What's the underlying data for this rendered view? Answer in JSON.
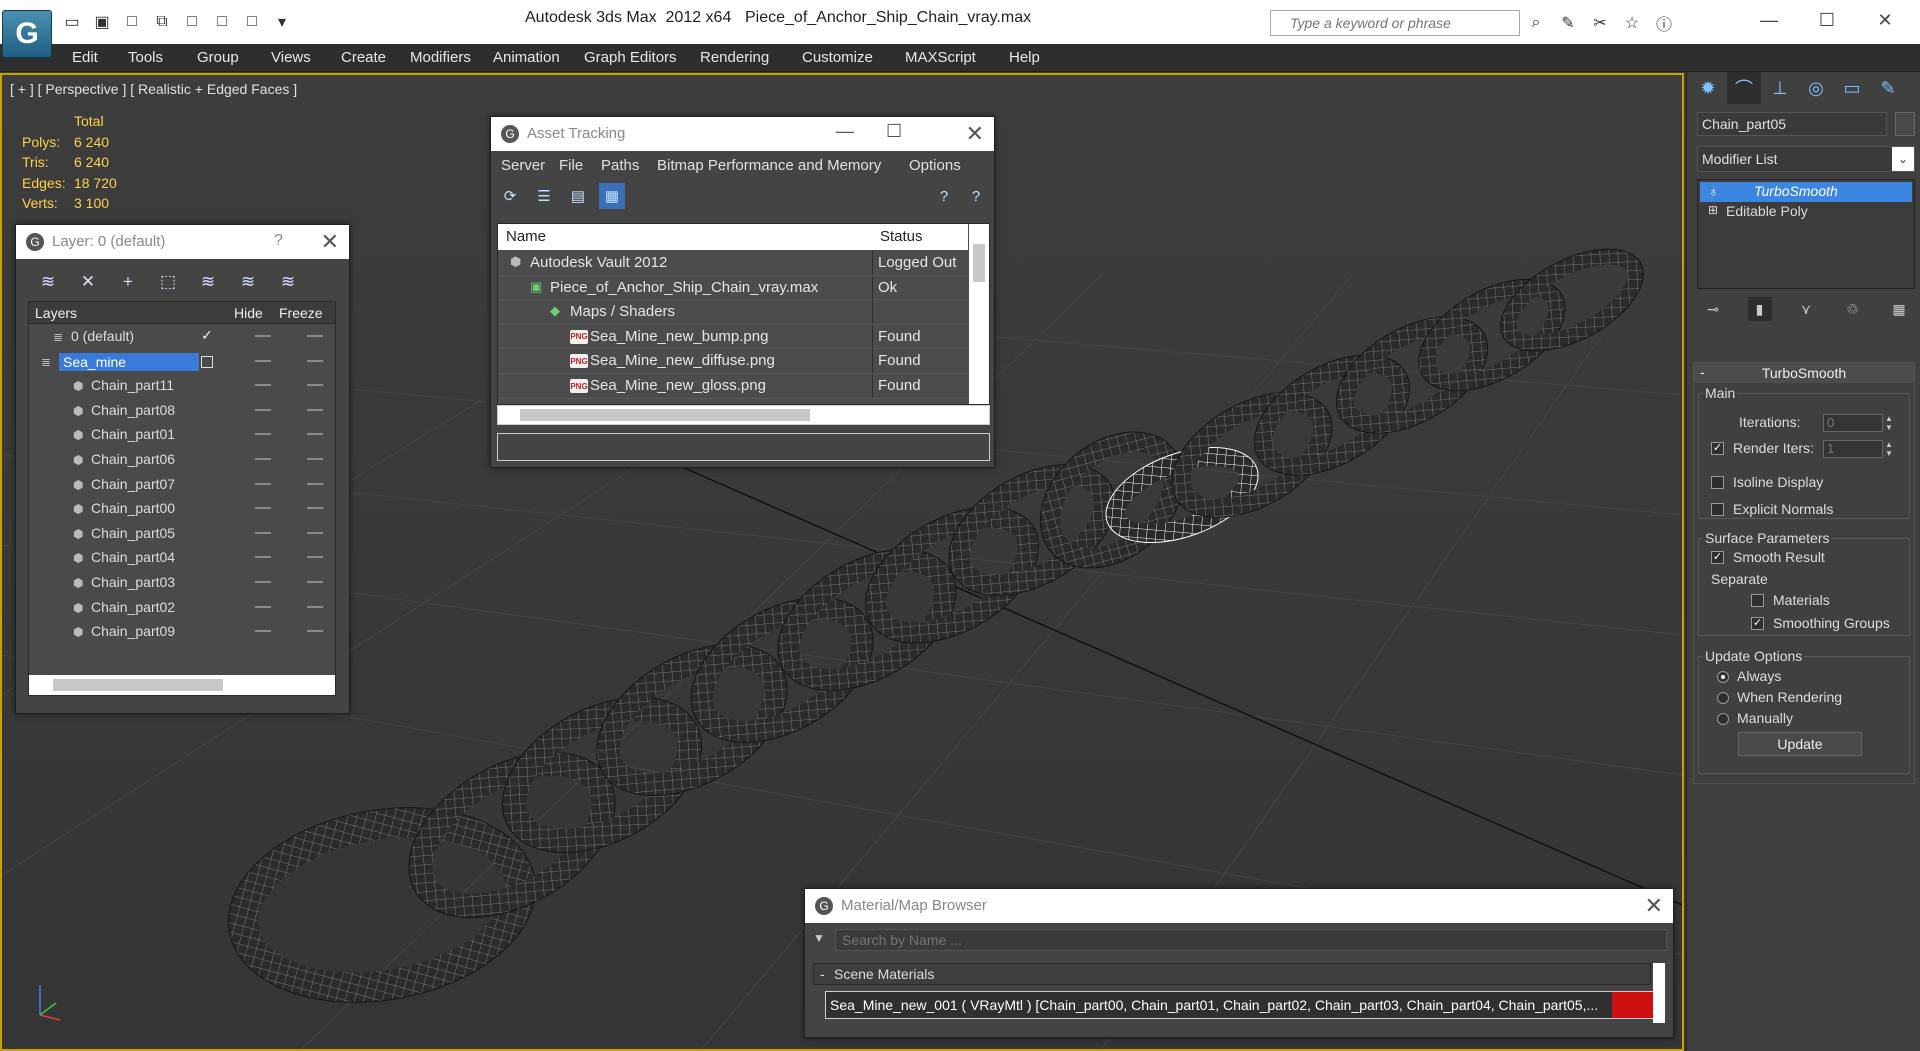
{
  "titlebar": {
    "app_title": "Autodesk 3ds Max  2012 x64",
    "file_name": "Piece_of_Anchor_Ship_Chain_vray.max",
    "search_placeholder": "Type a keyword or phrase"
  },
  "menu": [
    "Edit",
    "Tools",
    "Group",
    "Views",
    "Create",
    "Modifiers",
    "Animation",
    "Graph Editors",
    "Rendering",
    "Customize",
    "MAXScript",
    "Help"
  ],
  "viewport": {
    "label": "[ + ] [ Perspective ] [ Realistic + Edged Faces ]",
    "stats": {
      "header": "Total",
      "polys_label": "Polys:",
      "polys": "6 240",
      "tris_label": "Tris:",
      "tris": "6 240",
      "edges_label": "Edges:",
      "edges": "18 720",
      "verts_label": "Verts:",
      "verts": "3 100"
    }
  },
  "layer_window": {
    "title": "Layer: 0 (default)",
    "help": "?",
    "columns": {
      "layers": "Layers",
      "hide": "Hide",
      "freeze": "Freeze"
    },
    "rows": [
      "0 (default)",
      "Sea_mine",
      "Chain_part11",
      "Chain_part08",
      "Chain_part01",
      "Chain_part06",
      "Chain_part07",
      "Chain_part00",
      "Chain_part05",
      "Chain_part04",
      "Chain_part03",
      "Chain_part02",
      "Chain_part09"
    ]
  },
  "asset_window": {
    "title": "Asset Tracking",
    "menu": [
      "Server",
      "File",
      "Paths",
      "Bitmap Performance and Memory",
      "Options"
    ],
    "columns": {
      "name": "Name",
      "status": "Status"
    },
    "rows": [
      {
        "name": "Autodesk Vault 2012",
        "status": "Logged Out"
      },
      {
        "name": "Piece_of_Anchor_Ship_Chain_vray.max",
        "status": "Ok"
      },
      {
        "name": "Maps / Shaders",
        "status": ""
      },
      {
        "name": "Sea_Mine_new_bump.png",
        "status": "Found"
      },
      {
        "name": "Sea_Mine_new_diffuse.png",
        "status": "Found"
      },
      {
        "name": "Sea_Mine_new_gloss.png",
        "status": "Found"
      }
    ],
    "png_badge": "PNG"
  },
  "material_browser": {
    "title": "Material/Map Browser",
    "search_placeholder": "Search by Name ...",
    "section": "Scene Materials",
    "item": "Sea_Mine_new_001  ( VRayMtl )  [Chain_part00, Chain_part01, Chain_part02, Chain_part03, Chain_part04, Chain_part05,..."
  },
  "command_panel": {
    "object_name": "Chain_part05",
    "modifier_list": "Modifier List",
    "stack": [
      "TurboSmooth",
      "Editable Poly"
    ],
    "turbosmooth": {
      "title": "TurboSmooth",
      "main_group": "Main",
      "iterations_label": "Iterations:",
      "iterations": "0",
      "render_iters_label": "Render Iters:",
      "render_iters": "1",
      "isoline": "Isoline Display",
      "explicit": "Explicit Normals",
      "surface_group": "Surface Parameters",
      "smooth_result": "Smooth Result",
      "separate": "Separate",
      "materials": "Materials",
      "smoothing_groups": "Smoothing Groups",
      "update_group": "Update Options",
      "always": "Always",
      "when_rendering": "When Rendering",
      "manually": "Manually",
      "update_btn": "Update"
    }
  }
}
